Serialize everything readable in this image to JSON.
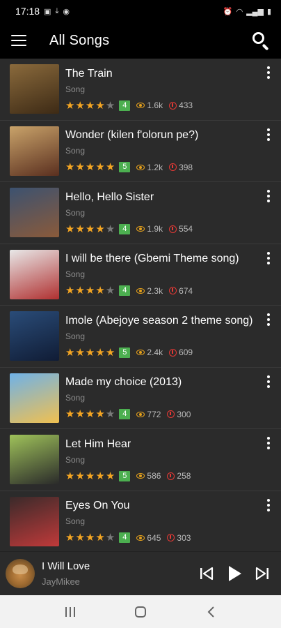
{
  "status_bar": {
    "time": "17:18",
    "left_icons": [
      "image-icon",
      "download-done-icon",
      "at-icon"
    ],
    "right_icons": [
      "alarm-icon",
      "wifi-icon",
      "signal-icon",
      "battery-icon"
    ]
  },
  "app_bar": {
    "title": "All Songs"
  },
  "songs": [
    {
      "title": "The Train",
      "type": "Song",
      "rating": 4,
      "rating_label": "4",
      "views": "1.6k",
      "downloads": "433",
      "art_colors": [
        "#8a6a3c",
        "#3d2a15"
      ]
    },
    {
      "title": "Wonder (kilen f'olorun pe?)",
      "type": "Song",
      "rating": 5,
      "rating_label": "5",
      "views": "1.2k",
      "downloads": "398",
      "art_colors": [
        "#c9a36a",
        "#5a2f1f"
      ]
    },
    {
      "title": "Hello, Hello Sister",
      "type": "Song",
      "rating": 4,
      "rating_label": "4",
      "views": "1.9k",
      "downloads": "554",
      "art_colors": [
        "#3c5270",
        "#8a5a3a"
      ]
    },
    {
      "title": "I will be there (Gbemi Theme song)",
      "type": "Song",
      "rating": 4,
      "rating_label": "4",
      "views": "2.3k",
      "downloads": "674",
      "art_colors": [
        "#e8e8e8",
        "#b03030"
      ]
    },
    {
      "title": "Imole (Abejoye season 2 theme song)",
      "type": "Song",
      "rating": 5,
      "rating_label": "5",
      "views": "2.4k",
      "downloads": "609",
      "art_colors": [
        "#2a4c78",
        "#101c35"
      ]
    },
    {
      "title": "Made my choice (2013)",
      "type": "Song",
      "rating": 4,
      "rating_label": "4",
      "views": "772",
      "downloads": "300",
      "art_colors": [
        "#6fb2e8",
        "#f0c050"
      ]
    },
    {
      "title": "Let Him Hear",
      "type": "Song",
      "rating": 5,
      "rating_label": "5",
      "views": "586",
      "downloads": "258",
      "art_colors": [
        "#9fc25a",
        "#2a2a2a"
      ]
    },
    {
      "title": "Eyes On You",
      "type": "Song",
      "rating": 4,
      "rating_label": "4",
      "views": "645",
      "downloads": "303",
      "art_colors": [
        "#3a2a2a",
        "#c03a3a"
      ]
    }
  ],
  "player": {
    "title": "I Will Love",
    "artist": "JayMikee"
  },
  "colors": {
    "background": "#2b2b2b",
    "star": "#f5a623",
    "badge": "#4caf50",
    "views_icon": "#e6a21c",
    "downloads_icon": "#e53935"
  }
}
